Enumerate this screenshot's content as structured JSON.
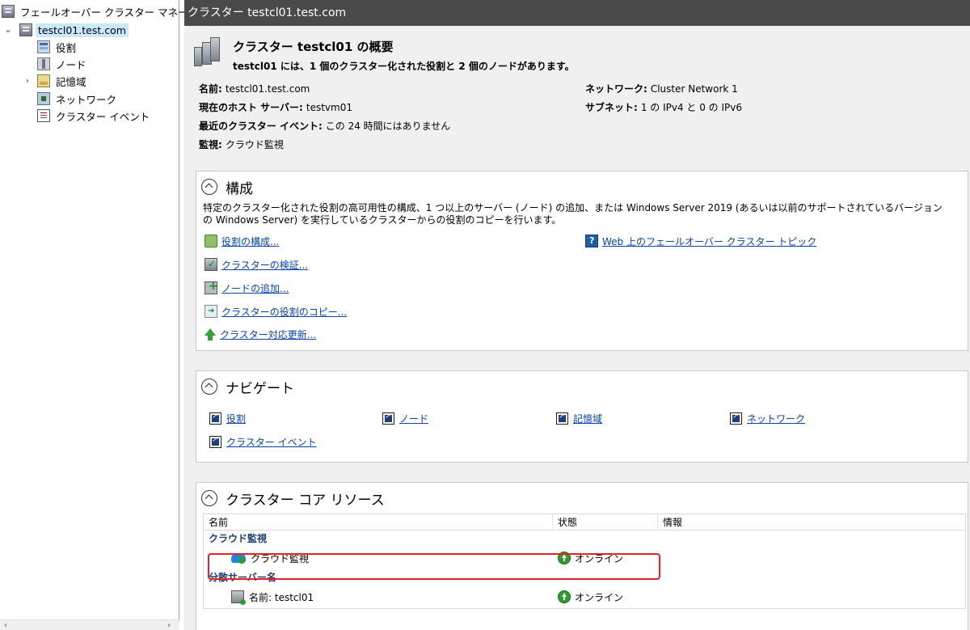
{
  "tree": {
    "root_label": "フェールオーバー クラスター マネージャー",
    "cluster_label": "testcl01.test.com",
    "items": [
      {
        "label": "役割",
        "icon": "roles-icon"
      },
      {
        "label": "ノード",
        "icon": "nodes-icon"
      },
      {
        "label": "記憶域",
        "icon": "storage-icon"
      },
      {
        "label": "ネットワーク",
        "icon": "network-icon"
      },
      {
        "label": "クラスター イベント",
        "icon": "events-icon"
      }
    ]
  },
  "header": {
    "title": "クラスター testcl01.test.com"
  },
  "summary": {
    "title": "クラスター testcl01 の概要",
    "subtitle": "testcl01 には、1 個のクラスター化された役割と 2 個のノードがあります。",
    "left": [
      {
        "key": "名前:",
        "value": "testcl01.test.com"
      },
      {
        "key": "現在のホスト サーバー:",
        "value": "testvm01"
      },
      {
        "key": "最近のクラスター イベント:",
        "value": "この 24 時間にはありません"
      },
      {
        "key": "監視:",
        "value": "クラウド監視"
      }
    ],
    "right": [
      {
        "key": "ネットワーク:",
        "value": "Cluster Network 1"
      },
      {
        "key": "サブネット:",
        "value": "1 の IPv4 と 0 の IPv6"
      }
    ]
  },
  "configure": {
    "title": "構成",
    "description": "特定のクラスター化された役割の高可用性の構成、1 つ以上のサーバー (ノード) の追加、または Windows Server 2019 (あるいは以前のサポートされているバージョンの Windows Server) を実行しているクラスターからの役割のコピーを行います。",
    "actions": [
      "役割の構成...",
      "クラスターの検証...",
      "ノードの追加...",
      "クラスターの役割のコピー...",
      "クラスター対応更新..."
    ],
    "web_link": "Web 上のフェールオーバー クラスター トピック"
  },
  "navigate": {
    "title": "ナビゲート",
    "links": [
      "役割",
      "ノード",
      "記憶域",
      "ネットワーク",
      "クラスター イベント"
    ]
  },
  "core": {
    "title": "クラスター コア リソース",
    "columns": [
      "名前",
      "状態",
      "情報"
    ],
    "groups": [
      {
        "label": "クラウド監視",
        "rows": [
          {
            "name": "クラウド監視",
            "status": "オンライン",
            "info": ""
          }
        ]
      },
      {
        "label": "分散サーバー名",
        "rows": [
          {
            "name": "名前: testcl01",
            "status": "オンライン",
            "info": ""
          }
        ]
      }
    ]
  },
  "colors": {
    "titlebar": "#4a4a4a",
    "link": "#0645ad",
    "highlight": "#e8202a",
    "selected": "#cce8ff",
    "online": "#2d9b2d"
  }
}
